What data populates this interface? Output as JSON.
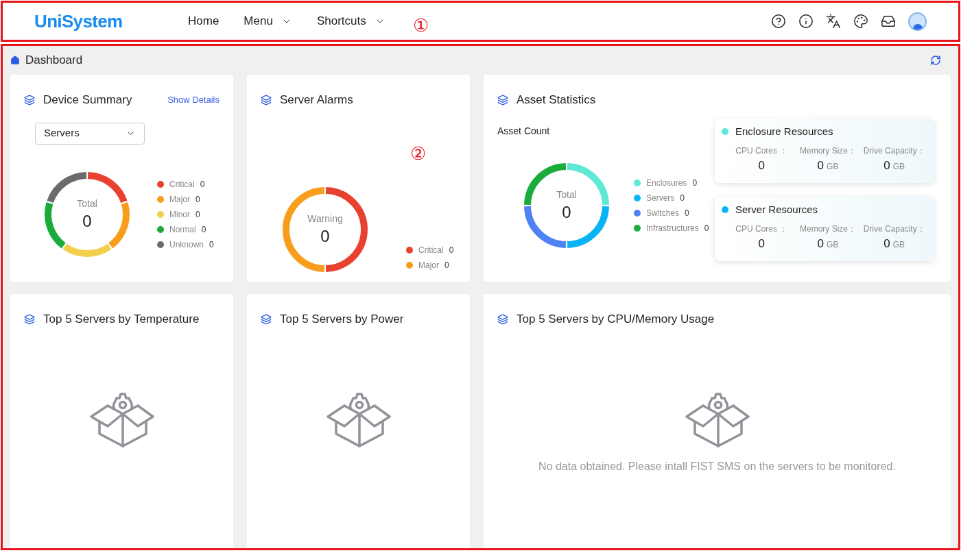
{
  "header": {
    "logo": "UniSystem",
    "nav": [
      {
        "label": "Home",
        "dropdown": false
      },
      {
        "label": "Menu",
        "dropdown": true
      },
      {
        "label": "Shortcuts",
        "dropdown": true
      }
    ]
  },
  "annotations": [
    "①",
    "②"
  ],
  "breadcrumb": "Dashboard",
  "device_summary": {
    "title": "Device Summary",
    "link": "Show Details",
    "select": "Servers",
    "center_label": "Total",
    "center_value": "0",
    "legend": [
      {
        "label": "Critical",
        "value": "0",
        "color": "#e8412f"
      },
      {
        "label": "Major",
        "value": "0",
        "color": "#f99d1c"
      },
      {
        "label": "Minor",
        "value": "0",
        "color": "#f2d04e"
      },
      {
        "label": "Normal",
        "value": "0",
        "color": "#1aab3a"
      },
      {
        "label": "Unknown",
        "value": "0",
        "color": "#6b6b6b"
      }
    ]
  },
  "server_alarms": {
    "title": "Server Alarms",
    "center_label": "Warning",
    "center_value": "0",
    "legend": [
      {
        "label": "Critical",
        "value": "0",
        "color": "#e8412f"
      },
      {
        "label": "Major",
        "value": "0",
        "color": "#f99d1c"
      }
    ]
  },
  "asset_statistics": {
    "title": "Asset Statistics",
    "subtitle": "Asset Count",
    "center_label": "Total",
    "center_value": "0",
    "legend": [
      {
        "label": "Enclosures",
        "value": "0",
        "color": "#5ee8d6"
      },
      {
        "label": "Servers",
        "value": "0",
        "color": "#0ab4f4"
      },
      {
        "label": "Switches",
        "value": "0",
        "color": "#4f82f5"
      },
      {
        "label": "Infrastructures",
        "value": "0",
        "color": "#1aab3a"
      }
    ],
    "resources": [
      {
        "title": "Enclosure Resources",
        "color": "#5ee8d6",
        "stats": [
          {
            "label": "CPU Cores ：",
            "value": "0"
          },
          {
            "label": "Memory Size：",
            "value": "0",
            "unit": "GB"
          },
          {
            "label": "Drive Capacity：",
            "value": "0",
            "unit": "GB"
          }
        ]
      },
      {
        "title": "Server Resources",
        "color": "#0ab4f4",
        "stats": [
          {
            "label": "CPU Cores ：",
            "value": "0"
          },
          {
            "label": "Memory Size：",
            "value": "0",
            "unit": "GB"
          },
          {
            "label": "Drive Capacity：",
            "value": "0",
            "unit": "GB"
          }
        ]
      }
    ]
  },
  "top_cards": [
    {
      "title": "Top 5 Servers by Temperature"
    },
    {
      "title": "Top 5 Servers by Power"
    },
    {
      "title": "Top 5 Servers by CPU/Memory Usage",
      "message": "No data obtained. Please intall FIST SMS on the servers to be monitored."
    }
  ]
}
